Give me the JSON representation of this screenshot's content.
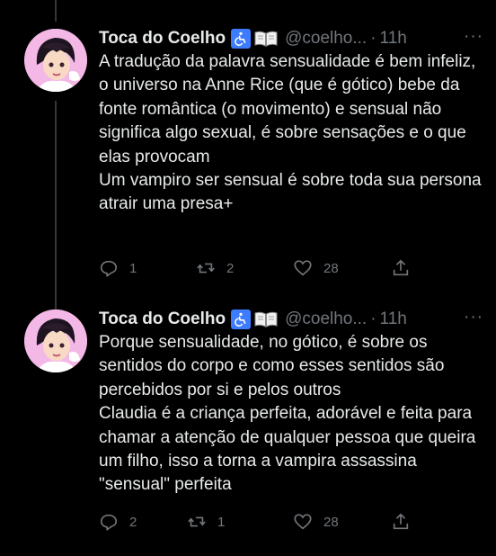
{
  "tweets": [
    {
      "name": "Toca do Coelho",
      "handle": "@coelho...",
      "dot": "·",
      "time": "11h",
      "more": "···",
      "text": "A tradução da palavra sensualidade é bem infeliz, o universo na Anne Rice (que é gótico) bebe da fonte romântica (o movimento) e sensual não significa algo sexual, é sobre sensações e o que elas provocam\nUm vampiro ser sensual é sobre toda sua persona atrair uma presa+",
      "replies": "1",
      "retweets": "2",
      "likes": "28"
    },
    {
      "name": "Toca do Coelho",
      "handle": "@coelho...",
      "dot": "·",
      "time": "11h",
      "more": "···",
      "text": "Porque sensualidade, no gótico, é sobre os sentidos do corpo e como esses sentidos são percebidos por si e pelos outros\nClaudia é a criança perfeita, adorável e feita para chamar a atenção de qualquer pessoa que queira um filho, isso a torna a vampira assassina \"sensual\" perfeita",
      "replies": "2",
      "retweets": "1",
      "likes": "28"
    }
  ],
  "icons": {
    "badge": "wheelchair-icon",
    "book": "book-icon",
    "reply": "reply-icon",
    "retweet": "retweet-icon",
    "like": "heart-icon",
    "share": "share-icon"
  },
  "colors": {
    "background": "#000000",
    "text": "#e7e9ea",
    "muted": "#71767b",
    "badge": "#3d7bff"
  }
}
